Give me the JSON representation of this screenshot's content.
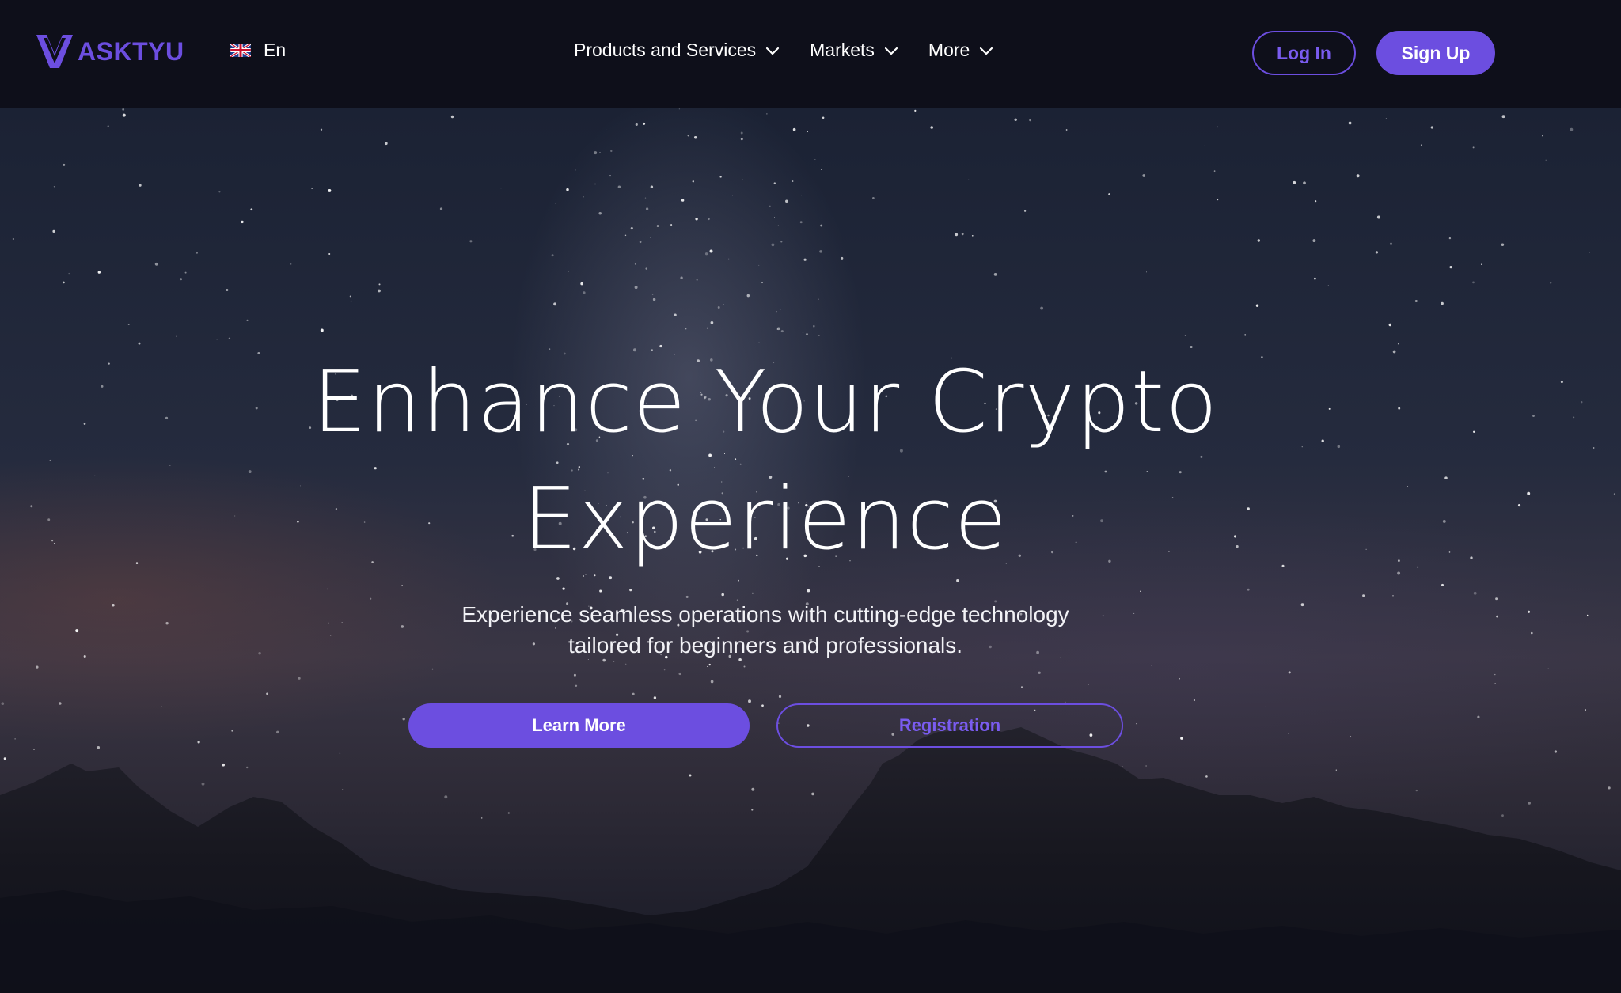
{
  "header": {
    "brand": "ASKTYU",
    "language": {
      "label": "En",
      "flag_icon": "uk-flag-icon"
    },
    "nav": [
      {
        "label": "Products and Services",
        "icon": "chevron-down-icon"
      },
      {
        "label": "Markets",
        "icon": "chevron-down-icon"
      },
      {
        "label": "More",
        "icon": "chevron-down-icon"
      }
    ],
    "login_label": "Log In",
    "signup_label": "Sign Up"
  },
  "hero": {
    "headline_line1": "Enhance Your Crypto",
    "headline_line2": "Experience",
    "subtext_line1": "Experience seamless operations with cutting-edge technology",
    "subtext_line2": "tailored for beginners and professionals.",
    "primary_cta": "Learn More",
    "secondary_cta": "Registration"
  },
  "colors": {
    "accent": "#6c4ee0",
    "accent_text": "#7a5cf0",
    "topbar_bg": "#0e0f1a",
    "text": "#ffffff"
  }
}
